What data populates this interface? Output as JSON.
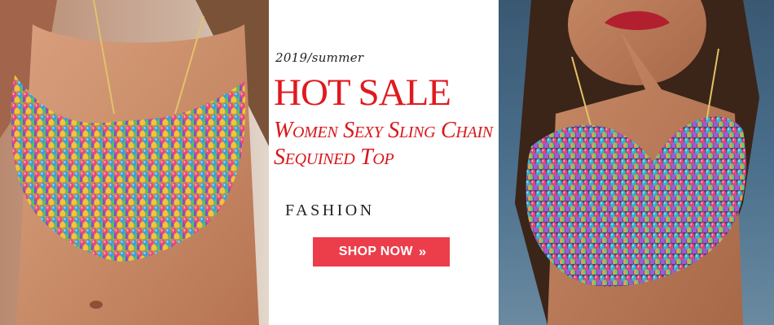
{
  "banner": {
    "year_label": "2019/summer",
    "headline": "HOT SALE",
    "subtitle_line1": "Women Sexy Sling Chain",
    "subtitle_line2": "Sequined Top",
    "category_label": "FASHION",
    "cta": {
      "label": "SHOP NOW",
      "icon": "double-chevron-right-icon",
      "icon_glyph": "»"
    }
  },
  "colors": {
    "headline": "#e0191e",
    "button": "#ec3d4a",
    "button_text": "#ffffff"
  },
  "images": [
    {
      "name": "product-photo-left",
      "description": "Model wearing multicolor sequin chain halter top"
    },
    {
      "name": "product-photo-right",
      "description": "Model wearing multicolor sequin chain halter top"
    }
  ]
}
